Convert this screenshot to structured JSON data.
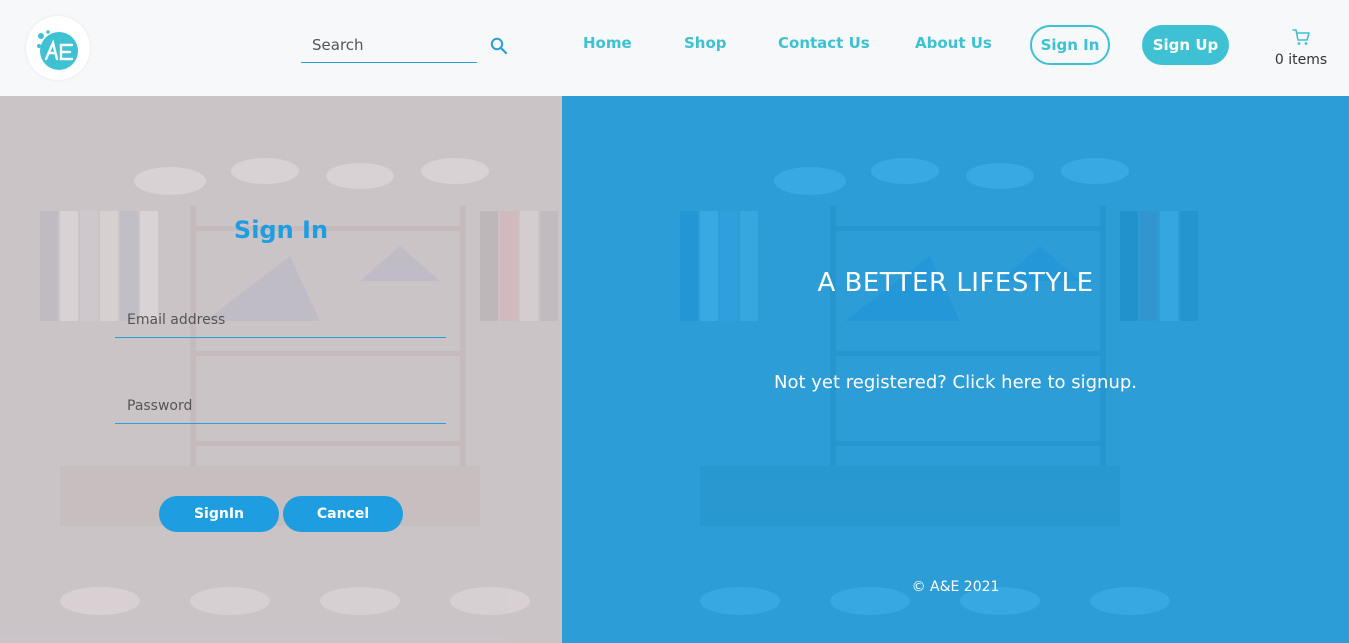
{
  "header": {
    "logo_text": "A&E",
    "search_placeholder": "Search",
    "nav": {
      "home": "Home",
      "shop": "Shop",
      "contact": "Contact Us",
      "about": "About Us"
    },
    "signin_label": "Sign In",
    "signup_label": "Sign Up",
    "cart_count": "0 items"
  },
  "signin_form": {
    "title": "Sign In",
    "email_placeholder": "Email address",
    "password_placeholder": "Password",
    "submit_label": "SignIn",
    "cancel_label": "Cancel"
  },
  "promo": {
    "tagline": "A BETTER LIFESTYLE",
    "signup_text": "Not yet registered? Click here to signup.",
    "footer": "© A&E 2021"
  },
  "colors": {
    "accent": "#3ec1d3",
    "primary": "#1e9ee0",
    "left_overlay": "#d6ced2",
    "right_overlay": "#20a0e2"
  },
  "icons": {
    "search": "search-icon",
    "cart": "cart-icon",
    "logo": "logo-icon"
  }
}
